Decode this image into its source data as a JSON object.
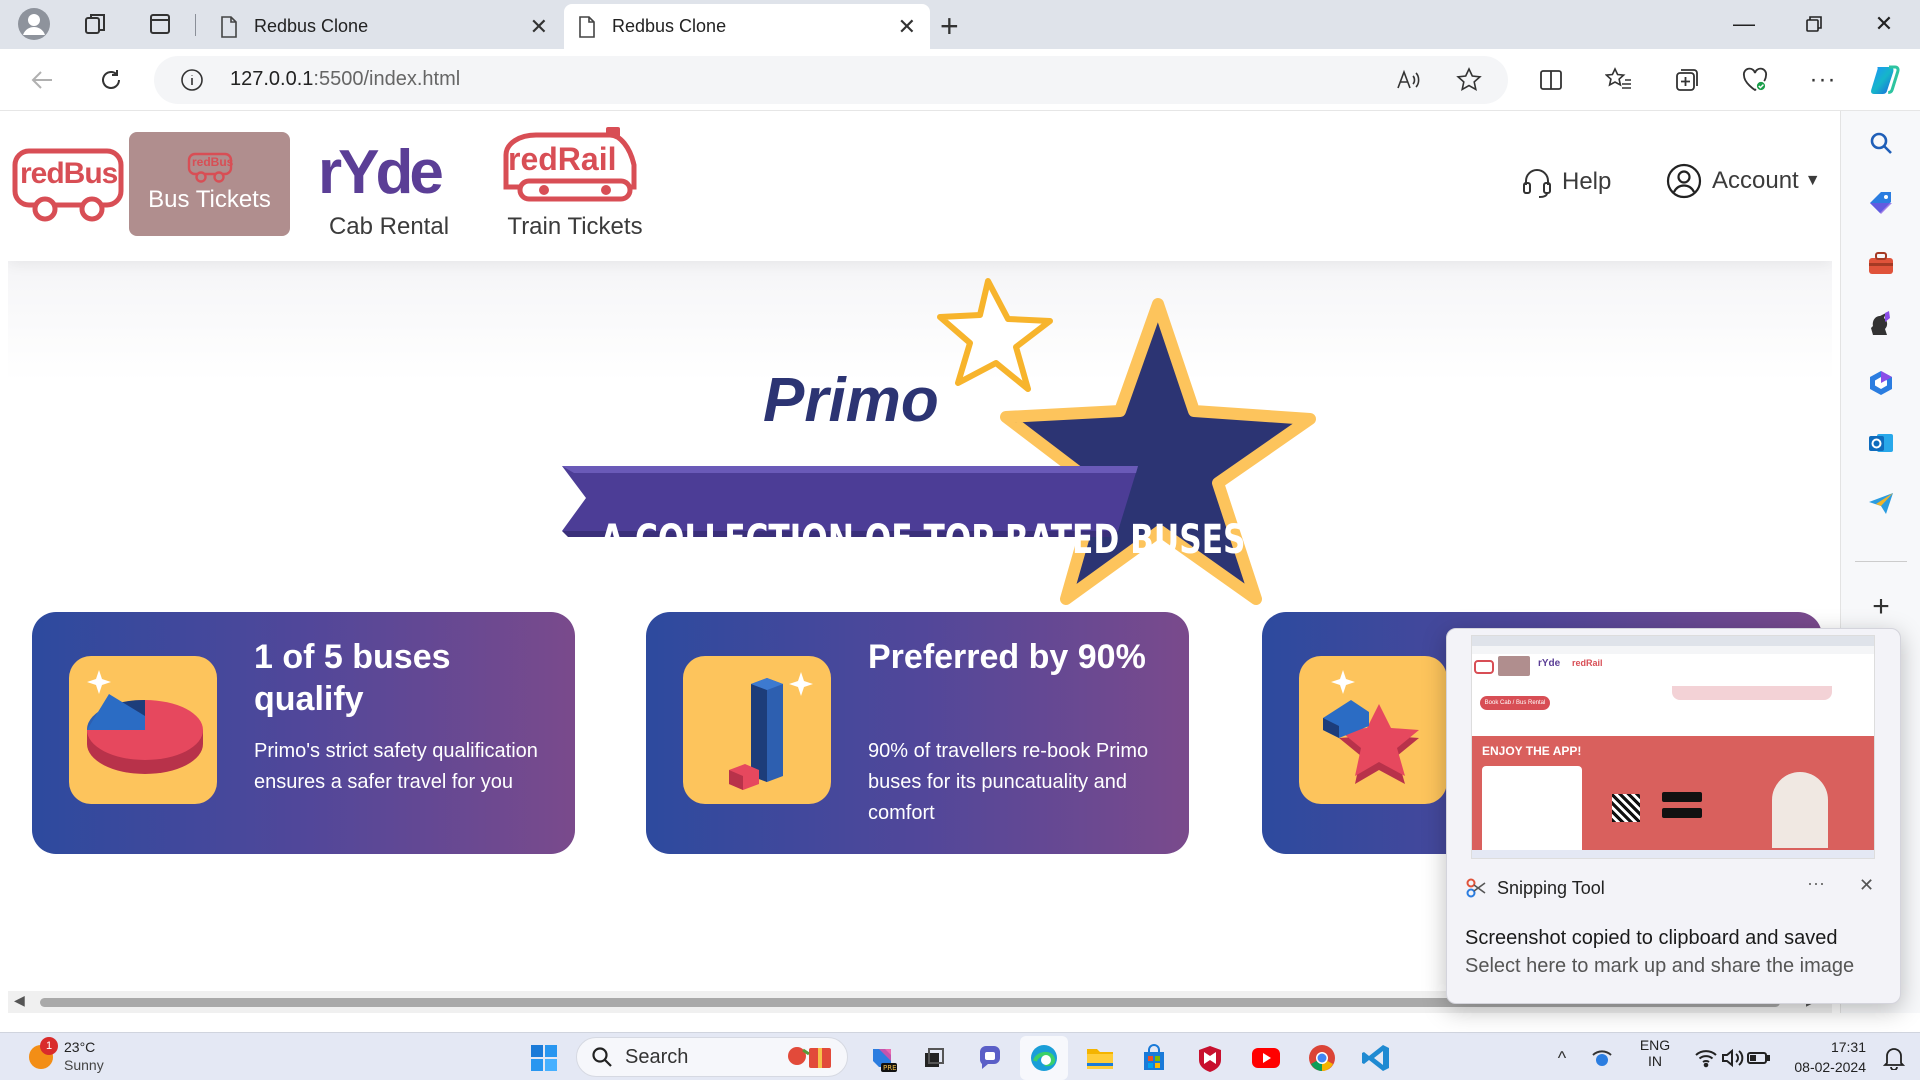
{
  "browser": {
    "tabs": [
      {
        "title": "Redbus Clone",
        "active": false
      },
      {
        "title": "Redbus Clone",
        "active": true
      }
    ],
    "url_host": "127.0.0.1",
    "url_path": ":5500/index.html"
  },
  "site": {
    "logo_text": "redBus",
    "nav": {
      "bus_tickets_badge": "redBus",
      "bus_tickets": "Bus Tickets",
      "ryde_logo": "rYde",
      "cab_rental": "Cab Rental",
      "redrail_logo": "redRail",
      "train_tickets": "Train Tickets"
    },
    "help": "Help",
    "account": "Account"
  },
  "primo": {
    "logo": "Primo",
    "banner": "A COLLECTION OF TOP RATED BUSES",
    "cards": [
      {
        "title": "1 of 5 buses qualify",
        "desc": "Primo's strict safety qualification ensures a safer travel for you"
      },
      {
        "title": "Preferred by 90%",
        "desc": "90% of travellers re-book Primo buses for its puncatuality and comfort"
      }
    ]
  },
  "snipping_toast": {
    "app_name": "Snipping Tool",
    "title": "Screenshot copied to clipboard and saved",
    "subtitle": "Select here to mark up and share the image",
    "more": "···",
    "preview": {
      "button": "Book Cab / Bus Rental",
      "heading": "ENJOY THE APP!"
    }
  },
  "taskbar": {
    "weather_temp": "23°C",
    "weather_desc": "Sunny",
    "weather_badge": "1",
    "search_placeholder": "Search",
    "lang_top": "ENG",
    "lang_bottom": "IN",
    "time": "17:31",
    "date": "08-02-2024"
  },
  "colors": {
    "brand_red": "#d84e55",
    "ryde_purple": "#5b3e96",
    "primo_navy": "#2c3473",
    "card_gradient_start": "#2d4a9e",
    "card_gradient_end": "#7a4a8c",
    "icon_yellow": "#fdc45c"
  }
}
